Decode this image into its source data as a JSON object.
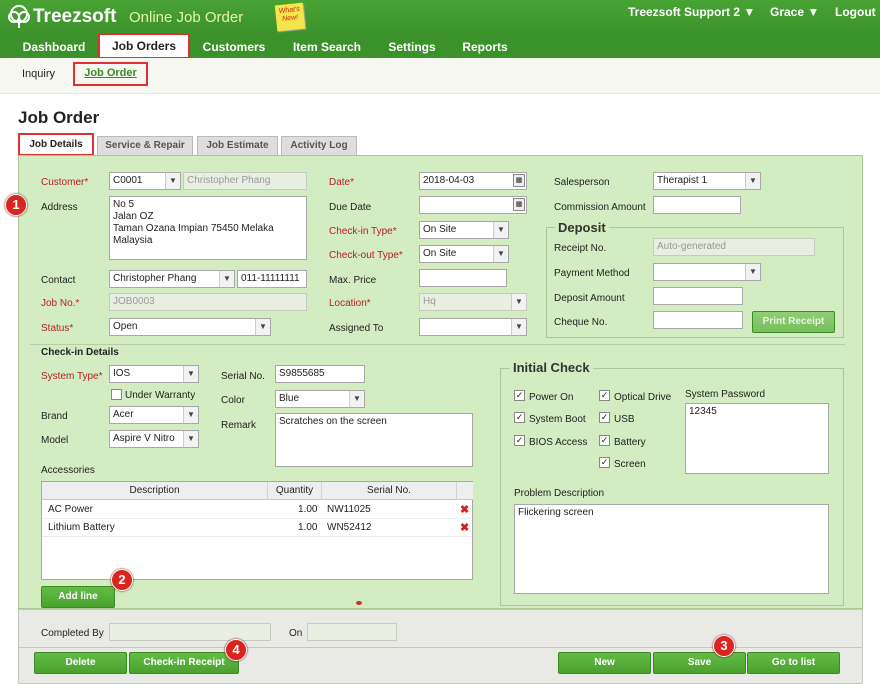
{
  "header": {
    "brand": "Treezsoft",
    "app_name": "Online Job Order",
    "note": "What's New!",
    "company": "Treezsoft Support 2 ▼",
    "user": "Grace ▼",
    "logout": "Logout"
  },
  "nav": [
    "Dashboard",
    "Job Orders",
    "Customers",
    "Item Search",
    "Settings",
    "Reports"
  ],
  "subnav": [
    "Inquiry",
    "Job Order"
  ],
  "page": {
    "title": "Job Order",
    "tabs": [
      "Job Details",
      "Service & Repair",
      "Job Estimate",
      "Activity Log"
    ]
  },
  "form": {
    "customer_label": "Customer*",
    "customer_code": "C0001",
    "customer_name": "Christopher Phang",
    "address_label": "Address",
    "address": "No 5\nJalan OZ\nTaman Ozana Impian 75450 Melaka\nMalaysia",
    "contact_label": "Contact",
    "contact_name": "Christopher Phang",
    "contact_phone": "011-11111111",
    "jobno_label": "Job No.*",
    "jobno": "JOB0003",
    "status_label": "Status*",
    "status": "Open",
    "date_label": "Date*",
    "date": "2018-04-03",
    "duedate_label": "Due Date",
    "duedate": "",
    "checkin_label": "Check-in Type*",
    "checkin": "On Site",
    "checkout_label": "Check-out Type*",
    "checkout": "On Site",
    "maxprice_label": "Max. Price",
    "maxprice": "",
    "location_label": "Location*",
    "location": "Hq",
    "assigned_label": "Assigned To",
    "assigned": "",
    "salesperson_label": "Salesperson",
    "salesperson": "Therapist 1",
    "commission_label": "Commission Amount",
    "commission": ""
  },
  "deposit": {
    "title": "Deposit",
    "receipt_label": "Receipt No.",
    "receipt_placeholder": "Auto-generated",
    "payment_label": "Payment Method",
    "amount_label": "Deposit Amount",
    "cheque_label": "Cheque No.",
    "print_button": "Print Receipt"
  },
  "checkin": {
    "title": "Check-in Details",
    "systype_label": "System Type*",
    "systype": "IOS",
    "warranty_label": "Under Warranty",
    "brand_label": "Brand",
    "brand": "Acer",
    "model_label": "Model",
    "model": "Aspire V Nitro",
    "serial_label": "Serial No.",
    "serial": "S9855685",
    "color_label": "Color",
    "color": "Blue",
    "remark_label": "Remark",
    "remark": "Scratches on the screen",
    "accessories_label": "Accessories"
  },
  "accessories": {
    "headers": [
      "Description",
      "Quantity",
      "Serial No."
    ],
    "rows": [
      {
        "desc": "AC Power",
        "qty": "1.00",
        "serial": "NW11025"
      },
      {
        "desc": "Lithium Battery",
        "qty": "1.00",
        "serial": "WN52412"
      }
    ],
    "add_button": "Add line"
  },
  "initial_check": {
    "title": "Initial Check",
    "items": [
      "Power On",
      "System Boot",
      "BIOS Access",
      "Optical Drive",
      "USB",
      "Battery",
      "Screen"
    ],
    "password_label": "System Password",
    "password": "12345",
    "problem_label": "Problem Description",
    "problem": "Flickering screen"
  },
  "footer": {
    "completed_label": "Completed By",
    "on_label": "On",
    "delete": "Delete",
    "checkin_receipt": "Check-in Receipt",
    "new": "New",
    "save": "Save",
    "goto_list": "Go to list"
  },
  "callouts": [
    "1",
    "2",
    "3",
    "4"
  ],
  "colors": {
    "brand_green": "#3c922a",
    "panel": "#d4ecc1",
    "required": "#b22222",
    "highlight": "#e03030"
  }
}
